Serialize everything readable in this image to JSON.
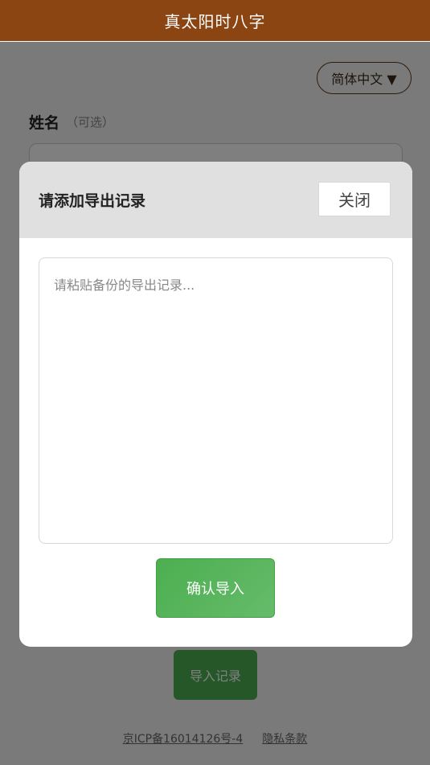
{
  "header": {
    "title": "真太阳时八字"
  },
  "language": {
    "selected": "简体中文 ▼"
  },
  "form": {
    "name_label": "姓名",
    "name_optional": "（可选）",
    "import_button": "导入记录"
  },
  "footer": {
    "icp": "京ICP备16014126号-4",
    "privacy": "隐私条款"
  },
  "modal": {
    "title": "请添加导出记录",
    "close_label": "关闭",
    "textarea_placeholder": "请粘贴备份的导出记录...",
    "textarea_value": "",
    "confirm_label": "确认导入"
  },
  "colors": {
    "header_bg": "#8b4513",
    "accent_green": "#4caf50"
  }
}
